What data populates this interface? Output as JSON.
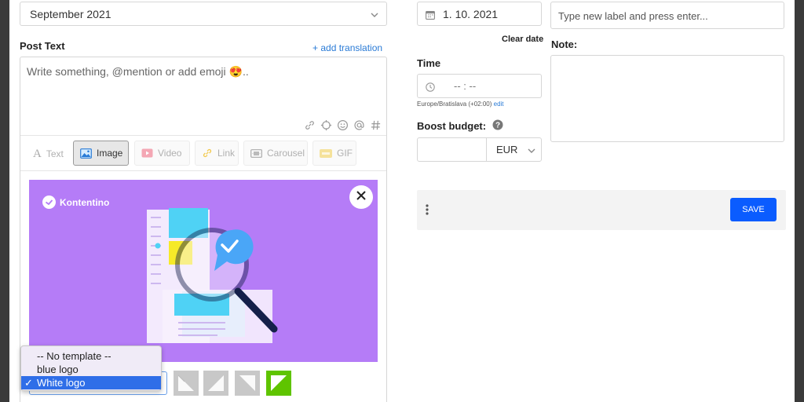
{
  "left": {
    "month_select": {
      "value": "September 2021"
    },
    "post_text": {
      "label": "Post Text",
      "add_translation": "+ add translation",
      "placeholder": "Write something, @mention or add emoji 😍.."
    },
    "tabs": [
      {
        "label": "Text",
        "icon": "text-icon"
      },
      {
        "label": "Image",
        "icon": "image-icon"
      },
      {
        "label": "Video",
        "icon": "video-icon"
      },
      {
        "label": "Link",
        "icon": "link-icon"
      },
      {
        "label": "Carousel",
        "icon": "carousel-icon"
      },
      {
        "label": "GIF",
        "icon": "gif-icon"
      }
    ],
    "active_tab": "Image",
    "image_card": {
      "brand": "Kontentino",
      "background": "#b57cf7"
    },
    "template_dropdown": {
      "options": [
        "-- No template --",
        "blue logo",
        "White logo"
      ],
      "selected": "White logo",
      "check": "✓"
    }
  },
  "right": {
    "date": {
      "value": "1. 10. 2021",
      "clear": "Clear date"
    },
    "labels": {
      "placeholder": "Type new label and press enter..."
    },
    "note": {
      "label": "Note:"
    },
    "time": {
      "label": "Time",
      "value": "-- : --",
      "timezone": "Europe/Bratislava (+02:00)",
      "edit": "edit"
    },
    "boost": {
      "label": "Boost budget:",
      "currency": "EUR"
    },
    "save_label": "SAVE"
  },
  "colors": {
    "accent": "#0a5cff",
    "link": "#2a7bd6",
    "purple": "#b57cf7",
    "green": "#5fc400"
  }
}
